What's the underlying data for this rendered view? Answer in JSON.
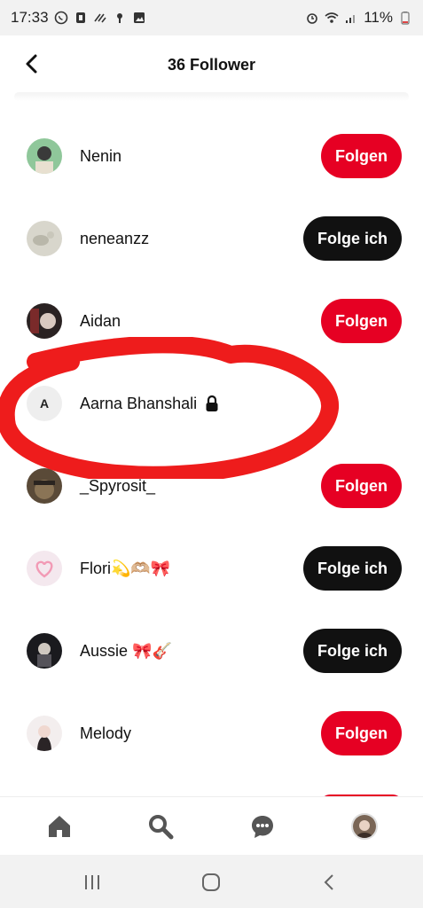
{
  "status_bar": {
    "time": "17:33",
    "battery": "11%",
    "left_icons": [
      "whatsapp-icon",
      "tiktok-icon",
      "signal-app-icon",
      "fan-icon",
      "gallery-icon"
    ],
    "right_icons": [
      "alarm-icon",
      "wifi-icon",
      "cell-signal-icon",
      "battery-icon"
    ]
  },
  "header": {
    "title": "36 Follower",
    "back_icon": "chevron-left-icon"
  },
  "followers": [
    {
      "name": "Nenin",
      "button": "Folgen",
      "button_style": "red",
      "avatar": "photo-green"
    },
    {
      "name": "neneanzz",
      "button": "Folge ich",
      "button_style": "black",
      "avatar": "photo-grey"
    },
    {
      "name": "Aidan",
      "button": "Folgen",
      "button_style": "red",
      "avatar": "photo-dark"
    },
    {
      "name": "Aarna Bhanshali",
      "initial": "A",
      "button": "",
      "button_style": "none",
      "private": true
    },
    {
      "name": "_Spyrosit_",
      "button": "Folgen",
      "button_style": "red",
      "avatar": "photo-brown"
    },
    {
      "name": "Flori💫🫶🏼🎀",
      "button": "Folge ich",
      "button_style": "black",
      "avatar": "photo-heart"
    },
    {
      "name": "Aussie 🎀🎸",
      "button": "Folge ich",
      "button_style": "black",
      "avatar": "photo-night"
    },
    {
      "name": "Melody",
      "button": "Folgen",
      "button_style": "red",
      "avatar": "photo-portrait"
    }
  ],
  "bottom_nav": {
    "items": [
      "home-icon",
      "search-icon",
      "messages-icon",
      "profile-avatar"
    ]
  },
  "colors": {
    "red": "#e60023",
    "black": "#111111",
    "annotation": "#ee1c1c"
  }
}
